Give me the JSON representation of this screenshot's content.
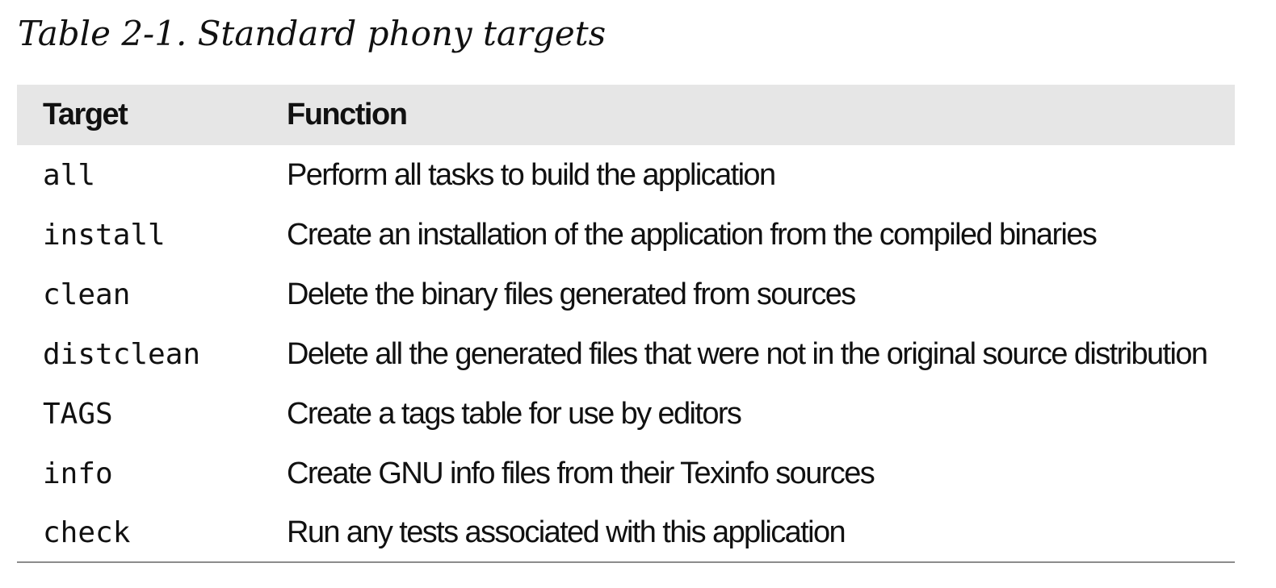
{
  "caption": "Table 2-1. Standard phony targets",
  "table": {
    "headers": [
      "Target",
      "Function"
    ],
    "rows": [
      {
        "target": "all",
        "function": "Perform all tasks to build the application"
      },
      {
        "target": "install",
        "function": "Create an installation of the application from the compiled binaries"
      },
      {
        "target": "clean",
        "function": "Delete the binary files generated from sources"
      },
      {
        "target": "distclean",
        "function": "Delete all the generated files that were not in the original source distribution"
      },
      {
        "target": "TAGS",
        "function": "Create a tags table for use by editors"
      },
      {
        "target": "info",
        "function": "Create GNU info files from their Texinfo sources"
      },
      {
        "target": "check",
        "function": "Run any tests associated with this application"
      }
    ]
  },
  "colors": {
    "header_bg": "#e6e6e6",
    "rule": "#8c8c8c",
    "text": "#111111"
  }
}
